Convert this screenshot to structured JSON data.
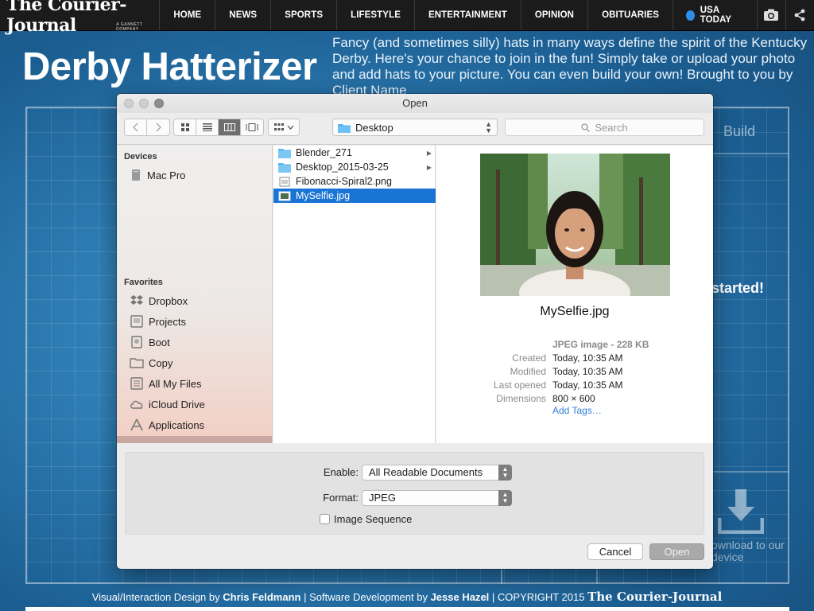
{
  "site": {
    "logo": "The Courier-Journal",
    "logo_tag": "A GANNETT COMPANY",
    "nav": [
      "HOME",
      "NEWS",
      "SPORTS",
      "LIFESTYLE",
      "ENTERTAINMENT",
      "OPINION",
      "OBITUARIES"
    ],
    "usatoday": "USA TODAY"
  },
  "page": {
    "title": "Derby Hatterizer",
    "intro": "Fancy (and sometimes silly) hats in many ways define the spirit of the Kentucky Derby. Here's your chance to join in the fun! Simply take or upload your photo and add hats to your picture. You can even build your own! Brought to you by Client Name"
  },
  "background_app": {
    "build_tab": "Build",
    "get_started": "started!",
    "download_text": "ownload to our device"
  },
  "footer": {
    "prefix": "Visual/Interaction Design by ",
    "designer": "Chris Feldmann",
    "mid": " | Software Development by ",
    "developer": "Jesse Hazel",
    "copyright": " | COPYRIGHT 2015 ",
    "logo": "The Courier-Journal"
  },
  "dialog": {
    "title": "Open",
    "location": "Desktop",
    "search_placeholder": "Search",
    "sidebar": {
      "devices_heading": "Devices",
      "devices": [
        {
          "label": "Mac Pro",
          "icon": "computer-icon"
        }
      ],
      "favorites_heading": "Favorites",
      "favorites": [
        {
          "label": "Dropbox",
          "icon": "dropbox-icon"
        },
        {
          "label": "Projects",
          "icon": "folder-icon"
        },
        {
          "label": "Boot",
          "icon": "drive-icon"
        },
        {
          "label": "Copy",
          "icon": "folder-icon"
        },
        {
          "label": "All My Files",
          "icon": "files-icon"
        },
        {
          "label": "iCloud Drive",
          "icon": "cloud-icon"
        },
        {
          "label": "Applications",
          "icon": "applications-icon"
        }
      ]
    },
    "files": [
      {
        "name": "Blender_271",
        "type": "folder",
        "has_children": true
      },
      {
        "name": "Desktop_2015-03-25",
        "type": "folder",
        "has_children": true
      },
      {
        "name": "Fibonacci-Spiral2.png",
        "type": "image",
        "has_children": false
      },
      {
        "name": "MySelfie.jpg",
        "type": "image",
        "has_children": false,
        "selected": true
      }
    ],
    "preview": {
      "filename": "MySelfie.jpg",
      "kind": "JPEG image - 228 KB",
      "rows": [
        {
          "key": "Created",
          "value": "Today, 10:35 AM"
        },
        {
          "key": "Modified",
          "value": "Today, 10:35 AM"
        },
        {
          "key": "Last opened",
          "value": "Today, 10:35 AM"
        },
        {
          "key": "Dimensions",
          "value": "800 × 600"
        }
      ],
      "add_tags": "Add Tags…"
    },
    "enable_label": "Enable:",
    "enable_value": "All Readable Documents",
    "format_label": "Format:",
    "format_value": "JPEG",
    "image_sequence": "Image Sequence",
    "cancel": "Cancel",
    "open": "Open"
  },
  "colors": {
    "nav_bg": "#1b1b1b",
    "page_bg": "#2f7fb6",
    "selection": "#1a74d6",
    "link": "#2a7fd6"
  }
}
